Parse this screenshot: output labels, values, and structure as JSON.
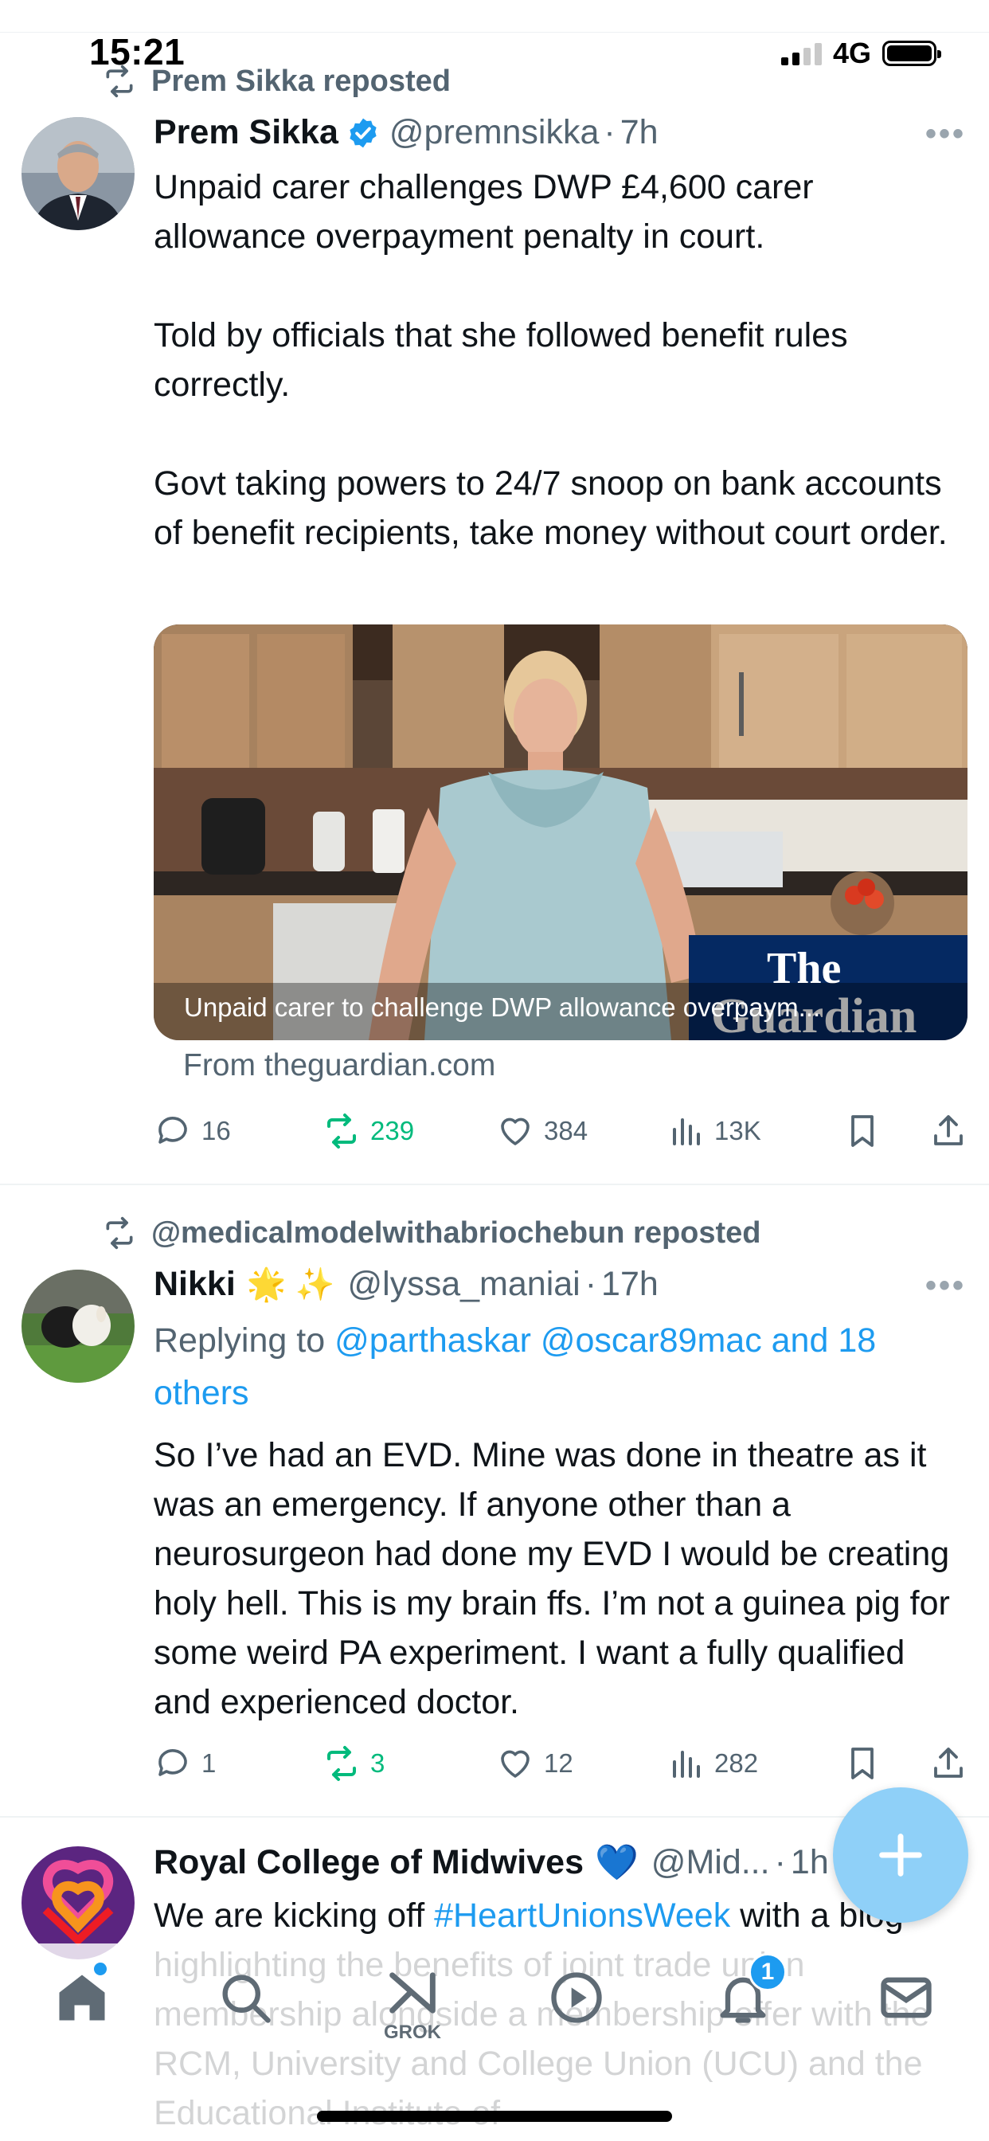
{
  "status_bar": {
    "time": "15:21",
    "network": "4G"
  },
  "tweets": [
    {
      "reposted_by": "Prem Sikka reposted",
      "name": "Prem Sikka",
      "handle": "@premnsikka",
      "time": "7h",
      "text": "Unpaid carer challenges DWP £4,600 carer allowance overpayment penalty in court.\n\nTold by officials that she followed benefit rules correctly.\n\nGovt taking powers to 24/7 snoop on bank accounts of benefit recipients, take money without court order.",
      "card": {
        "caption": "Unpaid carer to challenge DWP allowance overpaym...",
        "logo_line1": "The",
        "logo_line2": "Guardian",
        "source": "From theguardian.com"
      },
      "stats": {
        "replies": "16",
        "reposts": "239",
        "likes": "384",
        "views": "13K"
      }
    },
    {
      "reposted_by": "@medicalmodelwithabriochebun reposted",
      "name": "Nikki",
      "emojis": "🌟 ✨",
      "handle": "@lyssa_maniai",
      "time": "17h",
      "replying_prefix": "Replying to ",
      "replying_users": "@parthaskar @oscar89mac and 18",
      "replying_more": "others",
      "text": "So I’ve had an EVD. Mine was done in theatre as it was an emergency. If anyone other than a neurosurgeon had done my EVD I would be creating holy hell. This is my brain ffs. I’m not a guinea pig for some weird PA experiment. I want a fully qualified and experienced doctor.",
      "stats": {
        "replies": "1",
        "reposts": "3",
        "likes": "12",
        "views": "282"
      }
    },
    {
      "name": "Royal College of Midwives",
      "emoji": "💙",
      "handle": "@Mid...",
      "time": "1h",
      "text_before": "We are kicking off ",
      "hashtag": "#HeartUnionsWeek",
      "text_after": " with a blog highlighting the benefits of joint trade union membership alongside a membership offer with the RCM, University and College Union (UCU) and the Educational Institute of"
    }
  ],
  "nav": {
    "grok_label": "GROK",
    "notifications_count": "1"
  },
  "colors": {
    "accent": "#1d9bf0",
    "repost_green": "#00ba7c",
    "muted": "#536471"
  }
}
